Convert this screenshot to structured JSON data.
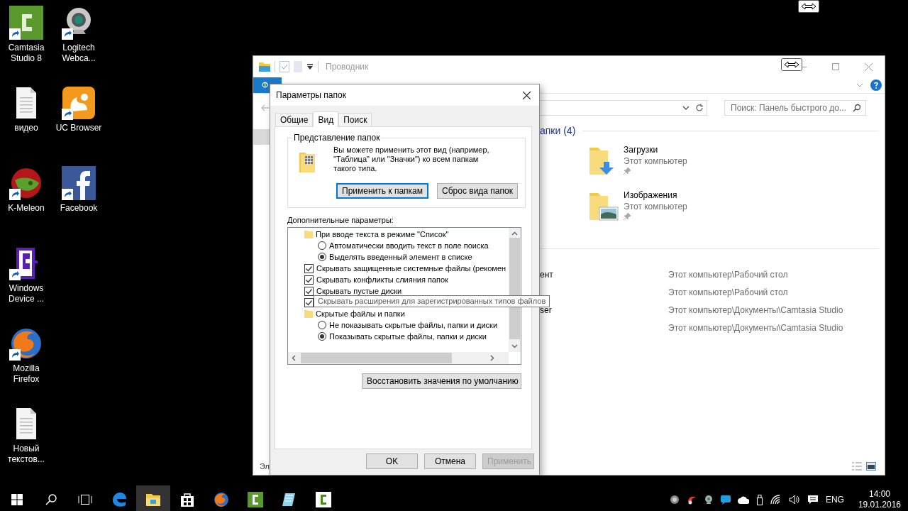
{
  "desktop": {
    "icons": [
      {
        "label": "Camtasia Studio 8",
        "kind": "camtasia",
        "shortcut": true
      },
      {
        "label": "видео",
        "kind": "document",
        "shortcut": false
      },
      {
        "label": "K-Meleon",
        "kind": "kmeleon",
        "shortcut": true
      },
      {
        "label": "Windows Device ...",
        "kind": "device",
        "shortcut": true
      },
      {
        "label": "Mozilla Firefox",
        "kind": "firefox",
        "shortcut": true
      },
      {
        "label": "Новый текстов...",
        "kind": "document",
        "shortcut": false
      },
      {
        "label": "Logitech Webca...",
        "kind": "webcam",
        "shortcut": true
      },
      {
        "label": "UC Browser",
        "kind": "ucbrowser",
        "shortcut": true
      },
      {
        "label": "Facebook",
        "kind": "facebook",
        "shortcut": true
      }
    ]
  },
  "explorer": {
    "title": "Проводник",
    "ribbon_tab": "Ф",
    "search": {
      "placeholder": "Поиск: Панель быстрого до..."
    },
    "group_header": "апки (4)",
    "folders": [
      {
        "name": "Загрузки",
        "location": "Этот компьютер",
        "kind": "downloads"
      },
      {
        "name": "Изображения",
        "location": "Этот компьютер",
        "kind": "pictures"
      }
    ],
    "recent": [
      {
        "name": "ент",
        "path": "Этот компьютер\\Рабочий стол"
      },
      {
        "path": "Этот компьютер\\Рабочий стол"
      },
      {
        "name": "ser",
        "path": "Этот компьютер\\Документы\\Camtasia Studio"
      },
      {
        "path": "Этот компьютер\\Документы\\Camtasia Studio"
      }
    ],
    "status": "Эл"
  },
  "dialog": {
    "title": "Параметры папок",
    "tabs": [
      {
        "label": "Общие",
        "selected": false
      },
      {
        "label": "Вид",
        "selected": true
      },
      {
        "label": "Поиск",
        "selected": false
      }
    ],
    "folder_views": {
      "title": "Представление папок",
      "text": "Вы можете применить этот вид (например, \"Таблица\" или \"Значки\") ко всем папкам такого типа.",
      "buttons": [
        {
          "label": "Применить к папкам",
          "focused": true
        },
        {
          "label": "Сброс вида папок",
          "focused": false
        }
      ]
    },
    "advanced_label": "Дополнительные параметры:",
    "settings": [
      {
        "kind": "folder",
        "label": "При вводе текста в режиме \"Список\"",
        "children": [
          {
            "kind": "radio",
            "label": "Автоматически вводить текст в поле поиска",
            "selected": false
          },
          {
            "kind": "radio",
            "label": "Выделять введенный элемент в списке",
            "selected": true
          }
        ]
      },
      {
        "kind": "checkbox",
        "label": "Скрывать защищенные системные файлы (рекомен",
        "checked": true
      },
      {
        "kind": "checkbox",
        "label": "Скрывать конфликты слияния папок",
        "checked": true
      },
      {
        "kind": "checkbox",
        "label": "Скрывать пустые диски",
        "checked": true
      },
      {
        "kind": "checkbox",
        "checked": true
      },
      {
        "kind": "folder",
        "label": "Скрытые файлы и папки",
        "children": [
          {
            "kind": "radio",
            "label": "Не показывать скрытые файлы, папки и диски",
            "selected": false
          },
          {
            "kind": "radio",
            "label": "Показывать скрытые файлы, папки и диски",
            "selected": true
          }
        ]
      }
    ],
    "tooltip": "Скрывать расширения для зарегистрированных типов файлов",
    "restore_button": "Восстановить значения по умолчанию",
    "buttons": [
      {
        "label": "OK",
        "disabled": false
      },
      {
        "label": "Отмена",
        "disabled": false
      },
      {
        "label": "Применить",
        "disabled": true
      }
    ]
  },
  "taskbar": {
    "apps": [
      {
        "kind": "edge",
        "active": false
      },
      {
        "kind": "explorer",
        "active": true
      },
      {
        "kind": "store",
        "active": false
      },
      {
        "kind": "firefox",
        "active": false
      },
      {
        "kind": "camtasia",
        "active": false
      },
      {
        "kind": "notes",
        "active": false
      },
      {
        "kind": "recorder",
        "active": false
      }
    ],
    "language": "ENG",
    "time": "14:00",
    "date": "19.01.2016"
  }
}
